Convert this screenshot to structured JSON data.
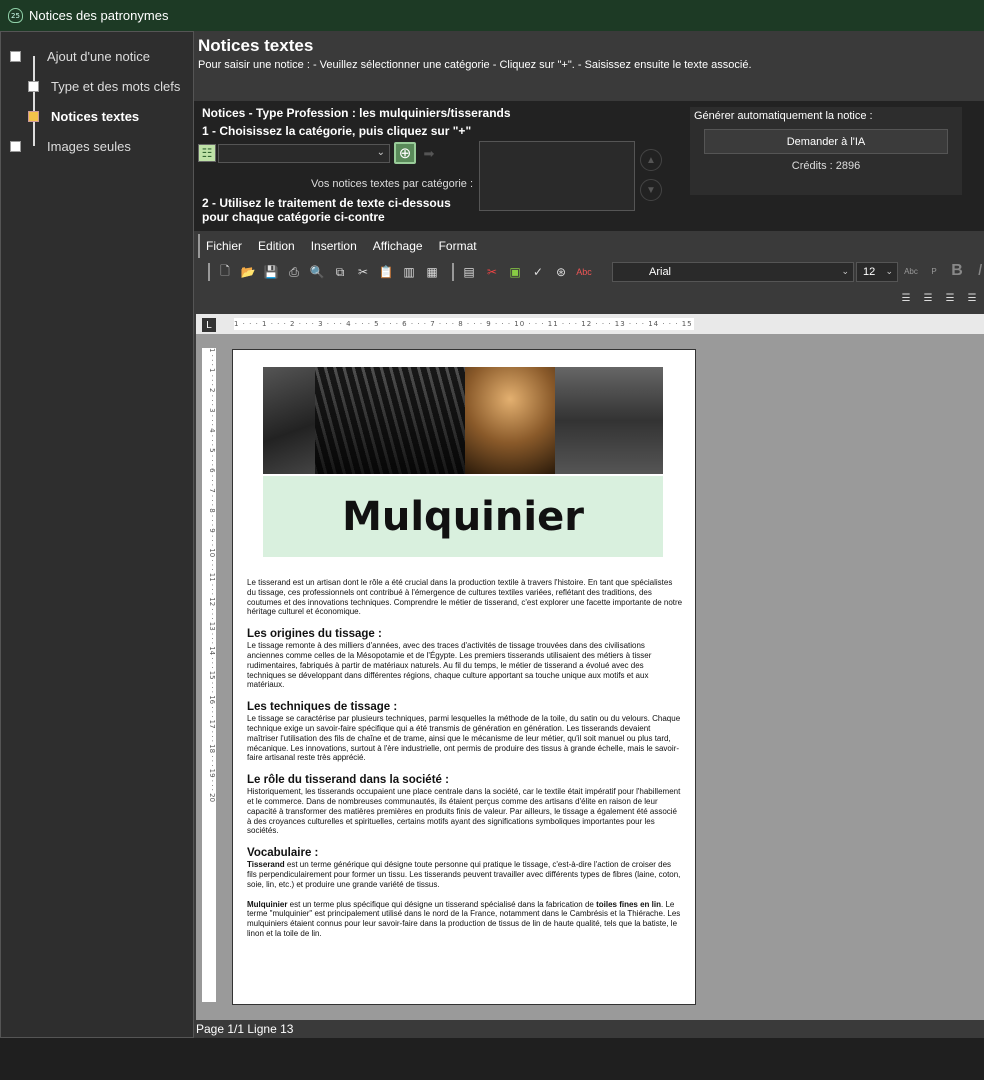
{
  "window": {
    "title": "Notices des patronymes",
    "icon": "app-shield-icon"
  },
  "sidebar": {
    "steps": [
      {
        "label": "Ajout d'une notice",
        "active": false
      },
      {
        "label": "Type et des mots clefs",
        "active": false
      },
      {
        "label": "Notices textes",
        "active": true
      },
      {
        "label": "Images seules",
        "active": false
      }
    ]
  },
  "header": {
    "title": "Notices textes",
    "subtitle": "Pour saisir une notice : - Veuillez sélectionner une catégorie - Cliquez sur \"+\". - Saisissez ensuite le texte associé."
  },
  "panel": {
    "notice_type": "Notices - Type Profession : les mulquiniers/tisserands",
    "step1": "1 - Choisissez la catégorie, puis cliquez sur \"+\"",
    "category_value": "",
    "list_label": "Vos notices textes par catégorie :",
    "step2_line1": "2 - Utilisez le traitement de texte ci-dessous",
    "step2_line2": "pour chaque catégorie ci-contre"
  },
  "ai": {
    "label": "Générer automatiquement la notice :",
    "button": "Demander à l'IA",
    "credits": "Crédits : 2896"
  },
  "menu": [
    "Fichier",
    "Edition",
    "Insertion",
    "Affichage",
    "Format"
  ],
  "format": {
    "font": "Arial",
    "size": "12"
  },
  "ruler": {
    "h": "1 · · · 1 · · · 2 · · · 3 · · · 4 · · · 5 · · · 6 · · · 7 · · · 8 · · · 9 · · · 10 · · · 11 · · · 12 · · · 13 · · · 14 · · · 15 · · · 16 · · · 17 · · · 18 · · · 19 · · · 20"
  },
  "document": {
    "banner_title": "Mulquinier",
    "intro": "Le tisserand est un artisan dont le rôle a été crucial dans la production textile à travers l'histoire. En tant que spécialistes du tissage, ces professionnels ont contribué à l'émergence de cultures textiles variées, reflétant des traditions, des coutumes et des innovations techniques. Comprendre le métier de tisserand, c'est explorer une facette importante de notre héritage culturel et économique.",
    "s1_title": "Les origines du tissage :",
    "s1_text": "Le tissage remonte à des milliers d'années, avec des traces d'activités de tissage trouvées dans des civilisations anciennes comme celles de la Mésopotamie et de l'Égypte. Les premiers tisserands utilisaient des métiers à tisser rudimentaires, fabriqués à partir de matériaux naturels. Au fil du temps, le métier de tisserand a évolué avec des techniques se développant dans différentes régions, chaque culture apportant sa touche unique aux motifs et aux matériaux.",
    "s2_title": "Les techniques de tissage :",
    "s2_text": "Le tissage se caractérise par plusieurs techniques, parmi lesquelles la méthode de la toile, du satin ou du velours. Chaque technique exige un savoir-faire spécifique qui a été transmis de génération en génération. Les tisserands devaient maîtriser l'utilisation des fils de chaîne et de trame, ainsi que le mécanisme de leur métier, qu'il soit manuel ou plus tard, mécanique. Les innovations, surtout à l'ère industrielle, ont permis de produire des tissus à grande échelle, mais le savoir-faire artisanal reste très apprécié.",
    "s3_title": "Le rôle du tisserand dans la société :",
    "s3_text": "Historiquement, les tisserands occupaient une place centrale dans la société, car le textile était impératif pour l'habillement et le commerce. Dans de nombreuses communautés, ils étaient perçus comme des artisans d'élite en raison de leur capacité à transformer des matières premières en produits finis de valeur. Par ailleurs, le tissage a également été associé à des croyances culturelles et spirituelles, certains motifs ayant des significations symboliques importantes pour les sociétés.",
    "s4_title": "Vocabulaire :",
    "v1_term": "Tisserand",
    "v1_text": " est un terme générique qui désigne toute personne qui pratique le tissage, c'est-à-dire l'action de croiser des fils perpendiculairement pour former un tissu. Les tisserands peuvent travailler avec différents types de fibres (laine, coton, soie, lin, etc.) et produire une grande variété de tissus.",
    "v2_term": "Mulquinier",
    "v2_text_a": " est un terme plus spécifique qui désigne un tisserand spécialisé dans la fabrication de ",
    "v2_bold": "toiles fines en lin",
    "v2_text_b": ". Le terme \"mulquinier\" est principalement utilisé dans le nord de la France, notamment dans le Cambrésis et la Thiérache. Les mulquiniers étaient connus pour leur savoir-faire dans la production de tissus de lin de haute qualité, tels que la batiste, le linon et la toile de lin."
  },
  "status": {
    "text": "Page 1/1 Ligne 13"
  }
}
